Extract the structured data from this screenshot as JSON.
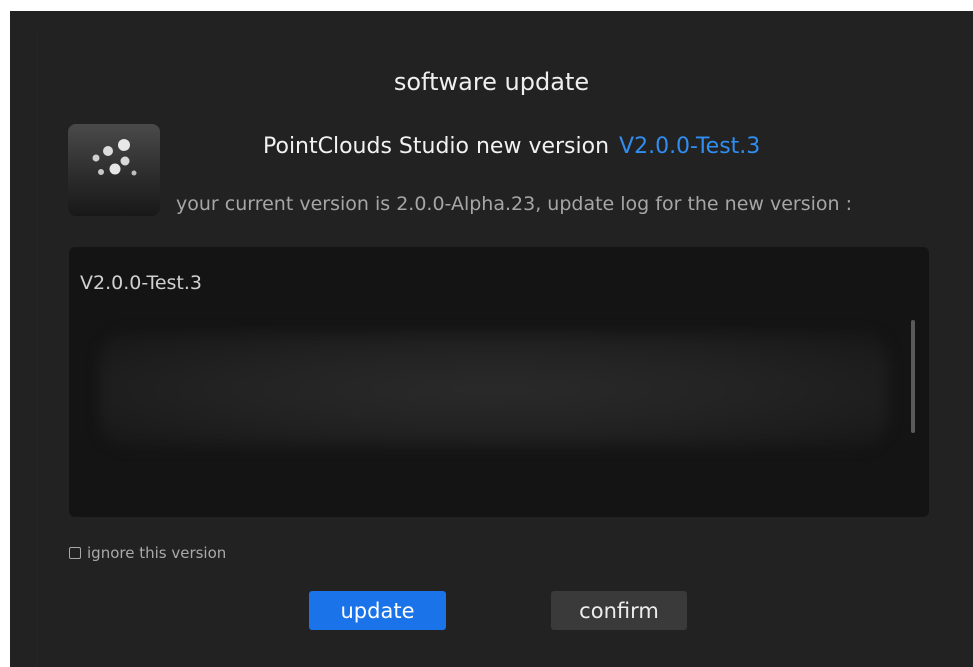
{
  "dialog": {
    "title": "software update",
    "headline": "PointClouds Studio new version",
    "new_version": "V2.0.0-Test.3",
    "current_version_text": "your current version is 2.0.0-Alpha.23, update log for the new version :"
  },
  "log": {
    "version_heading": "V2.0.0-Test.3"
  },
  "ignore": {
    "label": "ignore this version",
    "checked": false
  },
  "buttons": {
    "update_label": "update",
    "confirm_label": "confirm"
  },
  "colors": {
    "dialog_bg": "#222222",
    "accent": "#1a73e8",
    "version_link": "#2f8ef0"
  },
  "icons": {
    "app": "pointclouds-app-icon",
    "checkbox": "checkbox-unchecked-icon"
  }
}
